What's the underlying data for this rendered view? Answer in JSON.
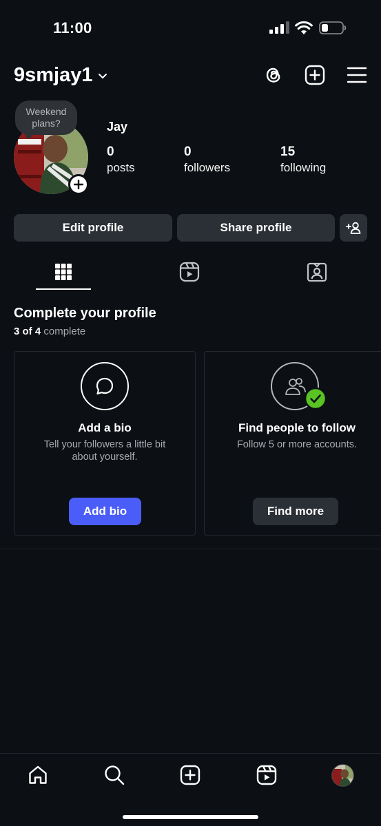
{
  "status_bar": {
    "time": "11:00",
    "signal_icon": "cellular-signal-icon",
    "wifi_icon": "wifi-icon",
    "battery_icon": "battery-icon"
  },
  "header": {
    "username": "9smjay1",
    "icons": [
      "threads-icon",
      "new-post-icon",
      "menu-icon"
    ]
  },
  "profile": {
    "note": "Weekend plans?",
    "display_name": "Jay",
    "stats": [
      {
        "value": "0",
        "label": "posts"
      },
      {
        "value": "0",
        "label": "followers"
      },
      {
        "value": "15",
        "label": "following"
      }
    ]
  },
  "actions": {
    "edit_profile": "Edit profile",
    "share_profile": "Share profile",
    "discover_people_icon": "add-person-icon"
  },
  "tabs": [
    {
      "icon": "grid-icon",
      "active": true
    },
    {
      "icon": "reels-icon",
      "active": false
    },
    {
      "icon": "tagged-icon",
      "active": false
    }
  ],
  "complete_profile": {
    "title": "Complete your profile",
    "progress_count": "3 of 4",
    "progress_label": "complete",
    "cards": [
      {
        "icon": "speech-bubble-icon",
        "title": "Add a bio",
        "description": "Tell your followers a little bit about yourself.",
        "button": "Add bio",
        "done": false
      },
      {
        "icon": "people-icon",
        "title": "Find people to follow",
        "description": "Follow 5 or more accounts.",
        "button": "Find more",
        "done": true
      }
    ]
  },
  "bottom_nav": {
    "items": [
      "home-icon",
      "search-icon",
      "create-icon",
      "reels-icon",
      "profile-avatar"
    ]
  },
  "colors": {
    "background": "#0c0f14",
    "button": "#2b2f36",
    "accent": "#4a5df9",
    "success": "#58c322"
  }
}
